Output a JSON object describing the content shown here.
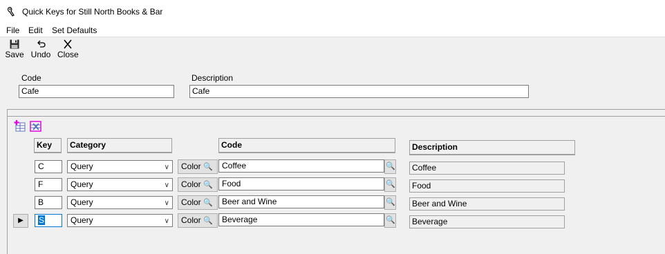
{
  "window": {
    "title": "Quick Keys for Still North Books & Bar"
  },
  "menu": [
    "File",
    "Edit",
    "Set Defaults"
  ],
  "toolbar": {
    "save": "Save",
    "undo": "Undo",
    "close": "Close"
  },
  "form": {
    "code_label": "Code",
    "code_value": "Cafe",
    "description_label": "Description",
    "description_value": "Cafe"
  },
  "grid": {
    "headers": {
      "key": "Key",
      "category": "Category",
      "code": "Code",
      "description": "Description"
    },
    "color_label": "Color",
    "rows": [
      {
        "key": "C",
        "category": "Query",
        "code": "Coffee",
        "description": "Coffee"
      },
      {
        "key": "F",
        "category": "Query",
        "code": "Food",
        "description": "Food"
      },
      {
        "key": "B",
        "category": "Query",
        "code": "Beer and Wine",
        "description": "Beer and Wine"
      },
      {
        "key": "S",
        "category": "Query",
        "code": "Beverage",
        "description": "Beverage"
      }
    ],
    "current_row_marker": "▶"
  }
}
